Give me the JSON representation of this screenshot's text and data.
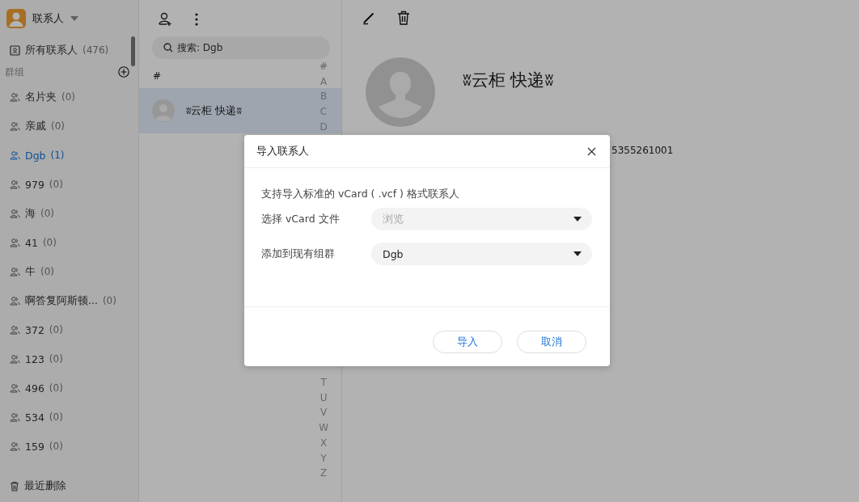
{
  "app": {
    "title": "联系人"
  },
  "sidebar": {
    "all_contacts": {
      "label": "所有联系人",
      "count": "(476)"
    },
    "groups_heading": "群组",
    "groups": [
      {
        "name": "名片夹",
        "count": "(0)",
        "selected": false
      },
      {
        "name": "亲戚",
        "count": "(0)",
        "selected": false
      },
      {
        "name": "Dgb",
        "count": "(1)",
        "selected": true
      },
      {
        "name": "979",
        "count": "(0)",
        "selected": false
      },
      {
        "name": "海",
        "count": "(0)",
        "selected": false
      },
      {
        "name": "41",
        "count": "(0)",
        "selected": false
      },
      {
        "name": "牛",
        "count": "(0)",
        "selected": false
      },
      {
        "name": "啊答复阿斯顿...",
        "count": "(0)",
        "selected": false
      },
      {
        "name": "372",
        "count": "(0)",
        "selected": false
      },
      {
        "name": "123",
        "count": "(0)",
        "selected": false
      },
      {
        "name": "496",
        "count": "(0)",
        "selected": false
      },
      {
        "name": "534",
        "count": "(0)",
        "selected": false
      },
      {
        "name": "159",
        "count": "(0)",
        "selected": false
      }
    ],
    "trash": "最近删除"
  },
  "contact_list": {
    "search": {
      "placeholder": "搜索: Dgb"
    },
    "section": "#",
    "contacts": [
      {
        "name": "ʬ云柜 快递ʬ",
        "selected": true
      }
    ],
    "index_top": [
      "#",
      "A",
      "B",
      "C",
      "D"
    ],
    "index_bottom": [
      "T",
      "U",
      "V",
      "W",
      "X",
      "Y",
      "Z"
    ]
  },
  "detail": {
    "name": "ʬ云柜 快递ʬ",
    "phone": "5355261001"
  },
  "dialog": {
    "title": "导入联系人",
    "description": "支持导入标准的 vCard ( .vcf ) 格式联系人",
    "fields": [
      {
        "label": "选择 vCard 文件",
        "placeholder": "浏览"
      },
      {
        "label": "添加到现有组群",
        "value": "Dgb"
      }
    ],
    "buttons": [
      "导入",
      "取消"
    ]
  }
}
